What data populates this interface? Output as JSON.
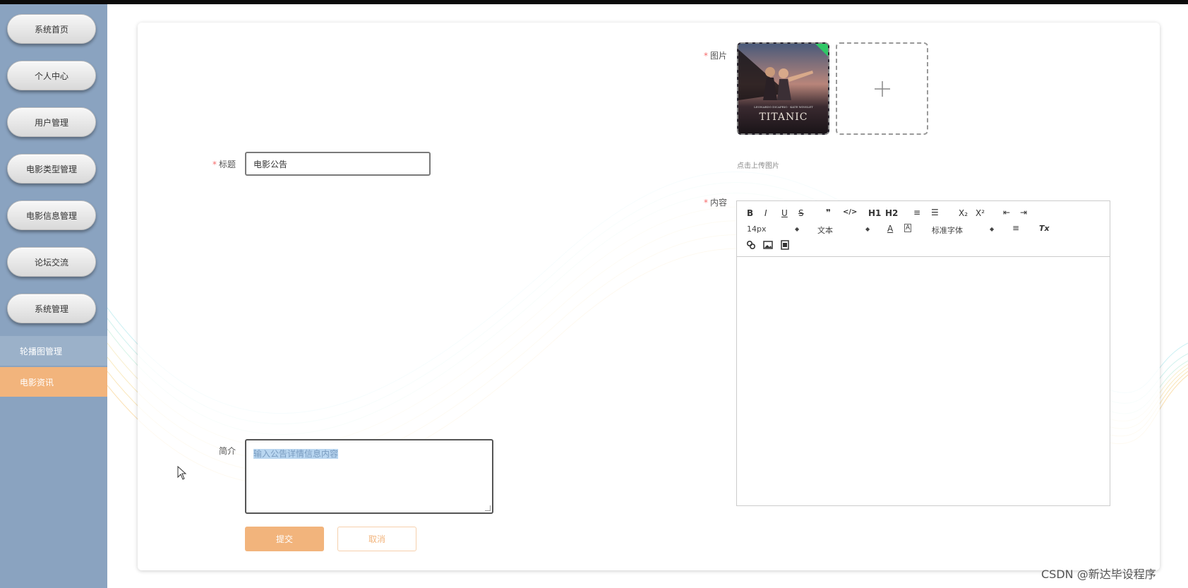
{
  "sidebar": {
    "items": [
      {
        "label": "系统首页"
      },
      {
        "label": "个人中心"
      },
      {
        "label": "用户管理"
      },
      {
        "label": "电影类型管理"
      },
      {
        "label": "电影信息管理"
      },
      {
        "label": "论坛交流"
      },
      {
        "label": "系统管理"
      }
    ],
    "sub_items": [
      {
        "label": "轮播图管理"
      },
      {
        "label": "电影资讯"
      }
    ]
  },
  "form": {
    "required_mark": "*",
    "image_label": "图片",
    "image_poster_text": "TITANIC",
    "upload_hint": "点击上传图片",
    "title_label": "标题",
    "title_value": "电影公告",
    "content_label": "内容",
    "intro_label": "简介",
    "intro_placeholder": "输入公告详情信息内容",
    "submit_label": "提交",
    "cancel_label": "取消"
  },
  "editor": {
    "row1": [
      "B",
      "I",
      "U",
      "S",
      "❞",
      "</>",
      "H1",
      "H2",
      "≡",
      "☰",
      "X₂",
      "X²",
      "⇤",
      "⇥"
    ],
    "font_size": "14px",
    "block_type": "文本",
    "font_family": "标准字体",
    "clear_format": "Tx"
  },
  "watermark": "CSDN @新达毕设程序",
  "colors": {
    "sidebar_bg": "#8aa3c0",
    "accent": "#f2b47c",
    "required": "#f56c6c"
  }
}
